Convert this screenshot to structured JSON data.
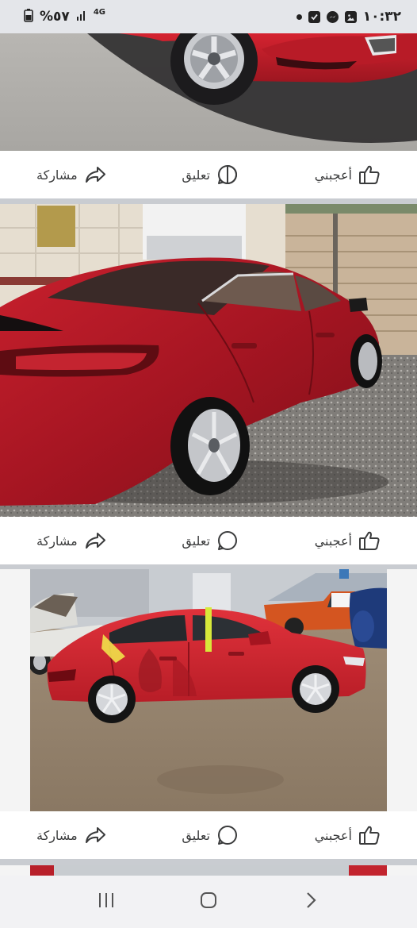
{
  "status_bar": {
    "time": "١٠:٣٢",
    "battery": "%٥٧",
    "network": "4G",
    "icons": [
      "dot-icon",
      "checkbox-icon",
      "messenger-icon",
      "gallery-icon",
      "battery-icon",
      "signal-icon"
    ]
  },
  "posts": [
    {
      "image": "red-sedan-front-wheel",
      "actions": {
        "like": "أعجبني",
        "comment": "تعليق",
        "share": "مشاركة"
      }
    },
    {
      "image": "red-sedan-rear-three-quarter",
      "actions": {
        "like": "أعجبني",
        "comment": "تعليق",
        "share": "مشاركة"
      }
    },
    {
      "image": "damaged-red-sedan-side",
      "actions": {
        "like": "أعجبني",
        "comment": "تعليق",
        "share": "مشاركة"
      }
    }
  ],
  "nav_bar": {
    "buttons": [
      "recent-apps",
      "home",
      "back"
    ]
  },
  "colors": {
    "car_red": "#c01f2b",
    "background": "#c9ccd1",
    "card": "#ffffff",
    "icon": "#3a3b3c"
  }
}
